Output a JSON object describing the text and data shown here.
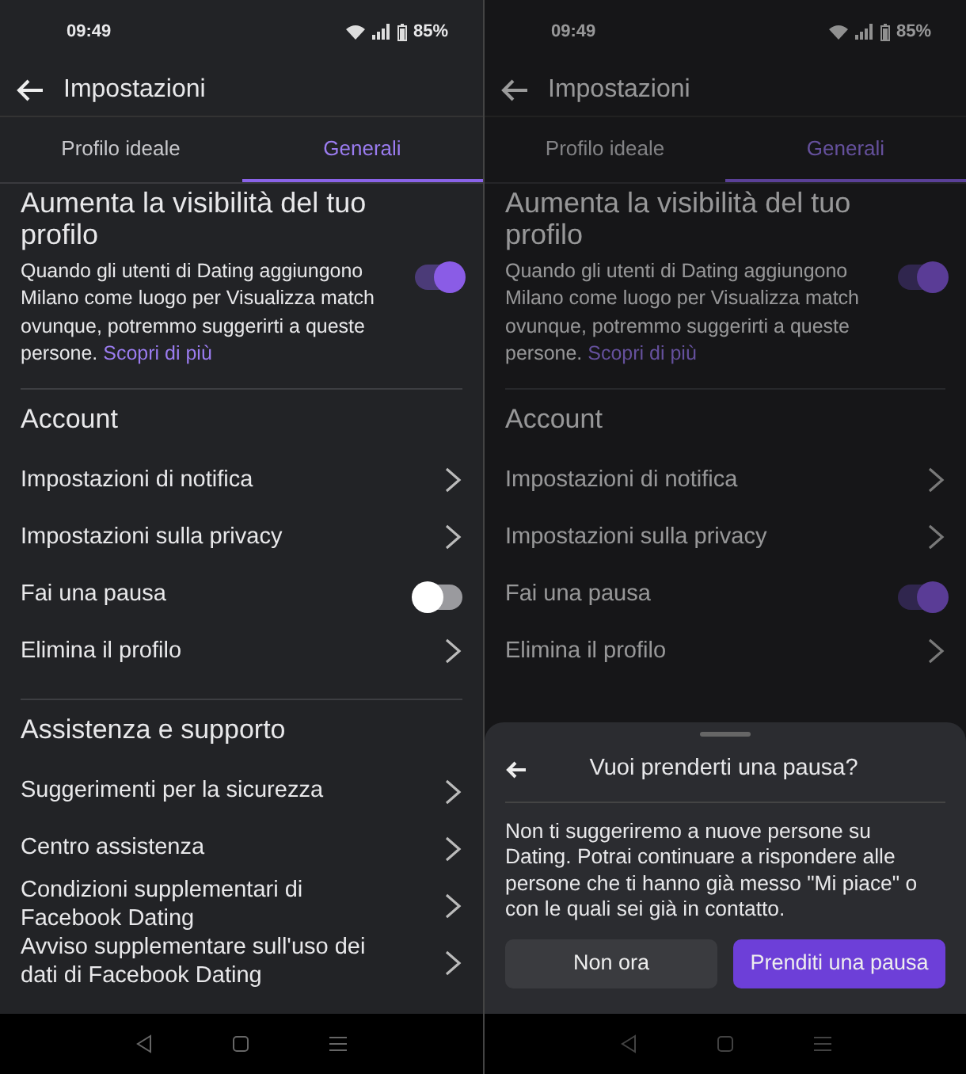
{
  "phones": [
    {
      "status_bar": {
        "time": "09:49",
        "battery": "85%"
      },
      "header": {
        "title": "Impostazioni"
      },
      "tabs": [
        {
          "label": "Profilo ideale",
          "selected": false
        },
        {
          "label": "Generali",
          "selected": true
        }
      ],
      "visibility": {
        "title": "Aumenta la visibilità del tuo profilo",
        "text": "Quando gli utenti di Dating aggiungono Milano come luogo per Visualizza match ovunque, potremmo suggerirti a queste persone.",
        "link": "Scopri di più",
        "on": true
      },
      "sections": [
        {
          "title": "Account",
          "items": [
            {
              "kind": "link",
              "label": "Impostazioni di notifica"
            },
            {
              "kind": "link",
              "label": "Impostazioni sulla privacy"
            },
            {
              "kind": "toggle",
              "label": "Fai una pausa",
              "on": false
            },
            {
              "kind": "link",
              "label": "Elimina il profilo"
            }
          ]
        },
        {
          "title": "Assistenza e supporto",
          "items": [
            {
              "kind": "link",
              "label": "Suggerimenti per la sicurezza"
            },
            {
              "kind": "link",
              "label": "Centro assistenza"
            },
            {
              "kind": "link",
              "label": "Condizioni supplementari di Facebook Dating"
            },
            {
              "kind": "link",
              "label": "Avviso supplementare sull'uso dei dati di Facebook Dating"
            }
          ]
        }
      ]
    },
    {
      "status_bar": {
        "time": "09:49",
        "battery": "85%"
      },
      "header": {
        "title": "Impostazioni"
      },
      "tabs": [
        {
          "label": "Profilo ideale",
          "selected": false
        },
        {
          "label": "Generali",
          "selected": true
        }
      ],
      "visibility": {
        "title": "Aumenta la visibilità del tuo profilo",
        "text": "Quando gli utenti di Dating aggiungono Milano come luogo per Visualizza match ovunque, potremmo suggerirti a queste persone.",
        "link": "Scopri di più",
        "on": true
      },
      "sections": [
        {
          "title": "Account",
          "items": [
            {
              "kind": "link",
              "label": "Impostazioni di notifica"
            },
            {
              "kind": "link",
              "label": "Impostazioni sulla privacy"
            },
            {
              "kind": "toggle",
              "label": "Fai una pausa",
              "on": true
            },
            {
              "kind": "link",
              "label": "Elimina il profilo"
            }
          ]
        }
      ],
      "sheet": {
        "title": "Vuoi prenderti una pausa?",
        "text": "Non ti suggeriremo a nuove persone su Dating. Potrai continuare a rispondere alle persone che ti hanno già messo \"Mi piace\" o con le quali sei già in contatto.",
        "buttons": [
          {
            "label": "Non ora",
            "primary": false
          },
          {
            "label": "Prenditi una pausa",
            "primary": true
          }
        ]
      }
    }
  ]
}
